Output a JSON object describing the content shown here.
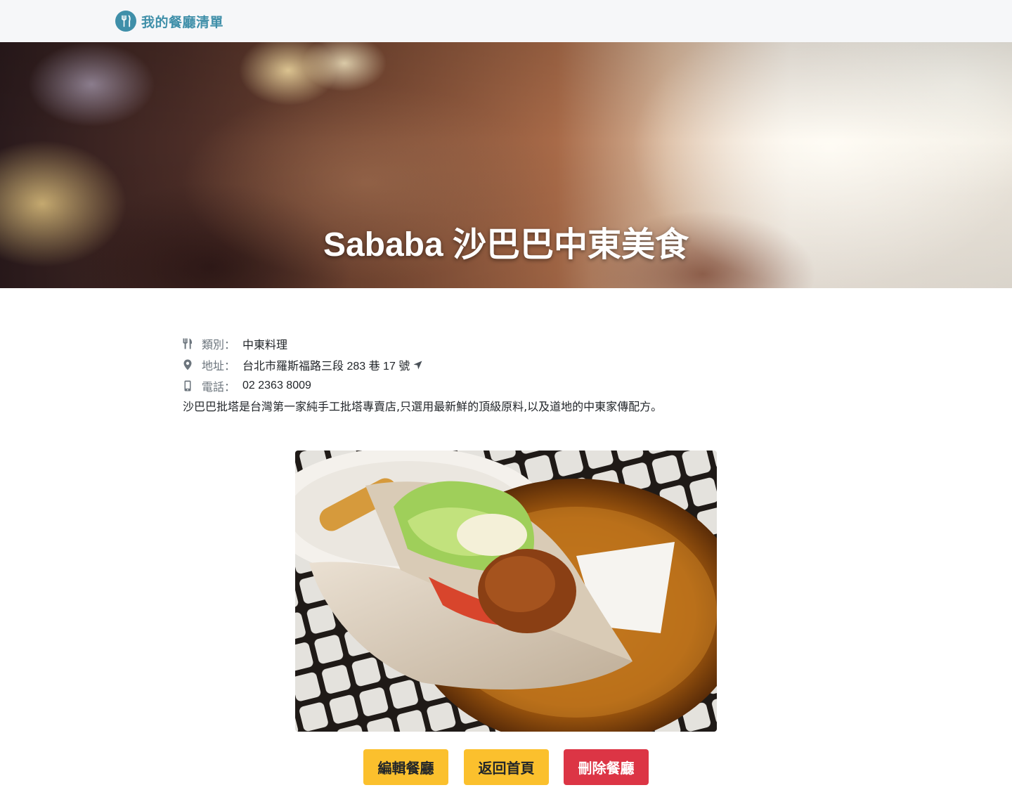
{
  "navbar": {
    "brand_icon": "utensils-icon",
    "brand_label": "我的餐廳清單",
    "brand_color": "#3f8fa9"
  },
  "hero": {
    "title": "Sababa 沙巴巴中東美食"
  },
  "restaurant": {
    "category_icon": "utensils-icon",
    "category_label": "類別：",
    "category": "中東料理",
    "address_icon": "map-marker-icon",
    "address_label": "地址：",
    "address": "台北市羅斯福路三段 283 巷 17 號",
    "address_link_icon": "location-arrow-icon",
    "phone_icon": "mobile-phone-icon",
    "phone_label": "電話：",
    "phone": "02 2363 8009",
    "description": "沙巴巴批塔是台灣第一家純手工批塔專賣店,只選用最新鮮的頂級原料,以及道地的中東家傳配方。"
  },
  "actions": {
    "edit_label": "編輯餐廳",
    "home_label": "返回首頁",
    "delete_label": "刪除餐廳",
    "warning_color": "#fbc02d",
    "danger_color": "#dc3545"
  }
}
